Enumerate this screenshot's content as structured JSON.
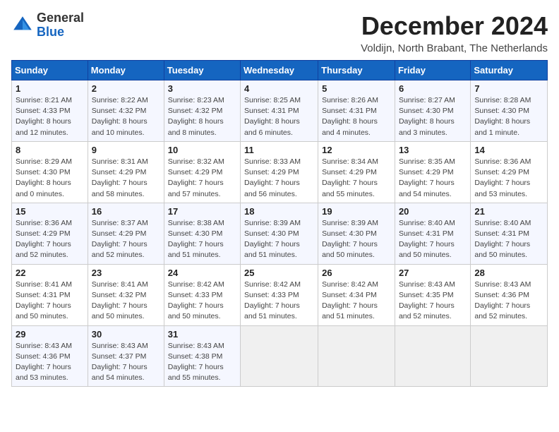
{
  "header": {
    "logo": {
      "line1": "General",
      "line2": "Blue"
    },
    "title": "December 2024",
    "location": "Voldijn, North Brabant, The Netherlands"
  },
  "weekdays": [
    "Sunday",
    "Monday",
    "Tuesday",
    "Wednesday",
    "Thursday",
    "Friday",
    "Saturday"
  ],
  "weeks": [
    [
      {
        "day": "1",
        "sunrise": "8:21 AM",
        "sunset": "4:33 PM",
        "daylight": "8 hours and 12 minutes."
      },
      {
        "day": "2",
        "sunrise": "8:22 AM",
        "sunset": "4:32 PM",
        "daylight": "8 hours and 10 minutes."
      },
      {
        "day": "3",
        "sunrise": "8:23 AM",
        "sunset": "4:32 PM",
        "daylight": "8 hours and 8 minutes."
      },
      {
        "day": "4",
        "sunrise": "8:25 AM",
        "sunset": "4:31 PM",
        "daylight": "8 hours and 6 minutes."
      },
      {
        "day": "5",
        "sunrise": "8:26 AM",
        "sunset": "4:31 PM",
        "daylight": "8 hours and 4 minutes."
      },
      {
        "day": "6",
        "sunrise": "8:27 AM",
        "sunset": "4:30 PM",
        "daylight": "8 hours and 3 minutes."
      },
      {
        "day": "7",
        "sunrise": "8:28 AM",
        "sunset": "4:30 PM",
        "daylight": "8 hours and 1 minute."
      }
    ],
    [
      {
        "day": "8",
        "sunrise": "8:29 AM",
        "sunset": "4:30 PM",
        "daylight": "8 hours and 0 minutes."
      },
      {
        "day": "9",
        "sunrise": "8:31 AM",
        "sunset": "4:29 PM",
        "daylight": "7 hours and 58 minutes."
      },
      {
        "day": "10",
        "sunrise": "8:32 AM",
        "sunset": "4:29 PM",
        "daylight": "7 hours and 57 minutes."
      },
      {
        "day": "11",
        "sunrise": "8:33 AM",
        "sunset": "4:29 PM",
        "daylight": "7 hours and 56 minutes."
      },
      {
        "day": "12",
        "sunrise": "8:34 AM",
        "sunset": "4:29 PM",
        "daylight": "7 hours and 55 minutes."
      },
      {
        "day": "13",
        "sunrise": "8:35 AM",
        "sunset": "4:29 PM",
        "daylight": "7 hours and 54 minutes."
      },
      {
        "day": "14",
        "sunrise": "8:36 AM",
        "sunset": "4:29 PM",
        "daylight": "7 hours and 53 minutes."
      }
    ],
    [
      {
        "day": "15",
        "sunrise": "8:36 AM",
        "sunset": "4:29 PM",
        "daylight": "7 hours and 52 minutes."
      },
      {
        "day": "16",
        "sunrise": "8:37 AM",
        "sunset": "4:29 PM",
        "daylight": "7 hours and 52 minutes."
      },
      {
        "day": "17",
        "sunrise": "8:38 AM",
        "sunset": "4:30 PM",
        "daylight": "7 hours and 51 minutes."
      },
      {
        "day": "18",
        "sunrise": "8:39 AM",
        "sunset": "4:30 PM",
        "daylight": "7 hours and 51 minutes."
      },
      {
        "day": "19",
        "sunrise": "8:39 AM",
        "sunset": "4:30 PM",
        "daylight": "7 hours and 50 minutes."
      },
      {
        "day": "20",
        "sunrise": "8:40 AM",
        "sunset": "4:31 PM",
        "daylight": "7 hours and 50 minutes."
      },
      {
        "day": "21",
        "sunrise": "8:40 AM",
        "sunset": "4:31 PM",
        "daylight": "7 hours and 50 minutes."
      }
    ],
    [
      {
        "day": "22",
        "sunrise": "8:41 AM",
        "sunset": "4:31 PM",
        "daylight": "7 hours and 50 minutes."
      },
      {
        "day": "23",
        "sunrise": "8:41 AM",
        "sunset": "4:32 PM",
        "daylight": "7 hours and 50 minutes."
      },
      {
        "day": "24",
        "sunrise": "8:42 AM",
        "sunset": "4:33 PM",
        "daylight": "7 hours and 50 minutes."
      },
      {
        "day": "25",
        "sunrise": "8:42 AM",
        "sunset": "4:33 PM",
        "daylight": "7 hours and 51 minutes."
      },
      {
        "day": "26",
        "sunrise": "8:42 AM",
        "sunset": "4:34 PM",
        "daylight": "7 hours and 51 minutes."
      },
      {
        "day": "27",
        "sunrise": "8:43 AM",
        "sunset": "4:35 PM",
        "daylight": "7 hours and 52 minutes."
      },
      {
        "day": "28",
        "sunrise": "8:43 AM",
        "sunset": "4:36 PM",
        "daylight": "7 hours and 52 minutes."
      }
    ],
    [
      {
        "day": "29",
        "sunrise": "8:43 AM",
        "sunset": "4:36 PM",
        "daylight": "7 hours and 53 minutes."
      },
      {
        "day": "30",
        "sunrise": "8:43 AM",
        "sunset": "4:37 PM",
        "daylight": "7 hours and 54 minutes."
      },
      {
        "day": "31",
        "sunrise": "8:43 AM",
        "sunset": "4:38 PM",
        "daylight": "7 hours and 55 minutes."
      },
      null,
      null,
      null,
      null
    ]
  ]
}
